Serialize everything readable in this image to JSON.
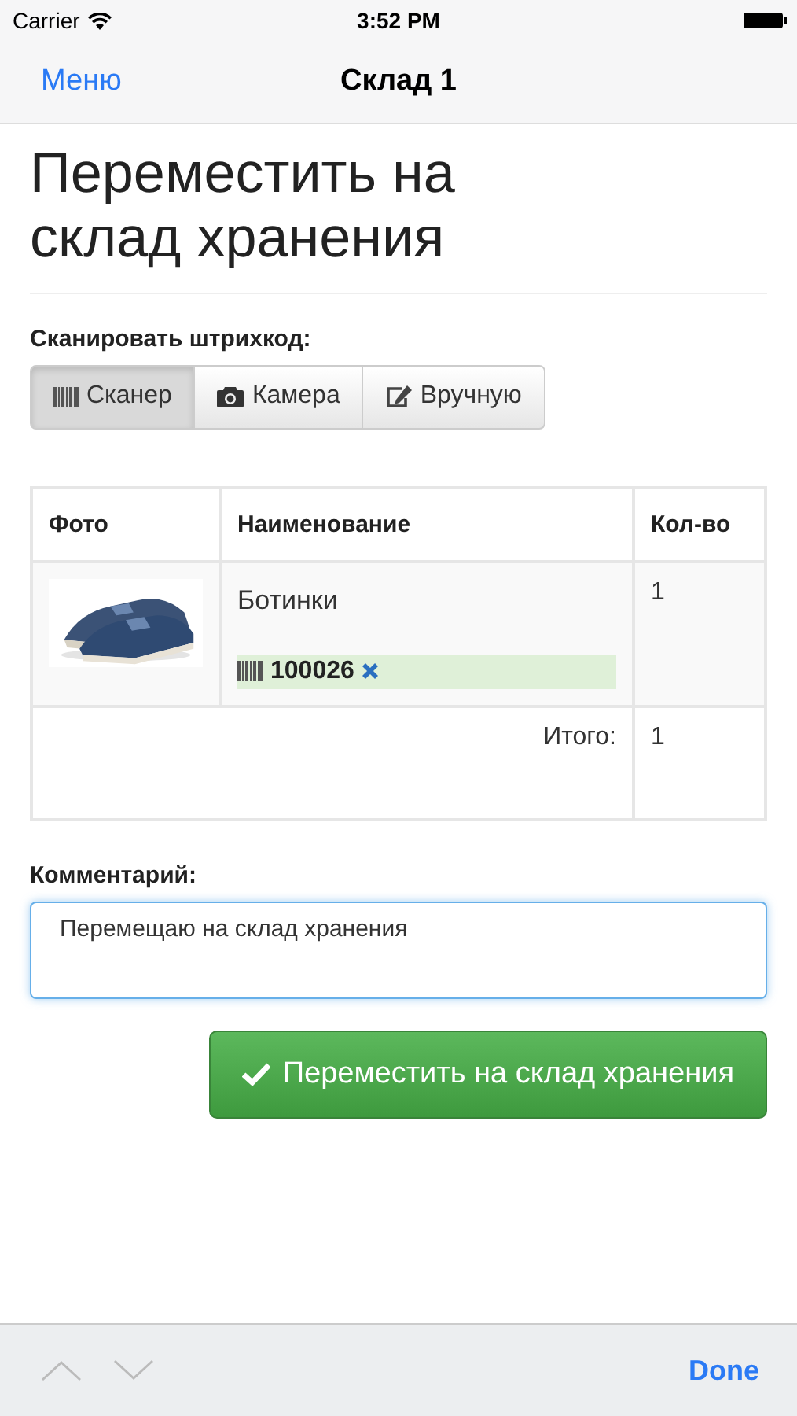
{
  "status_bar": {
    "carrier": "Carrier",
    "time": "3:52 PM"
  },
  "nav": {
    "back": "Меню",
    "title": "Склад 1"
  },
  "heading": "Переместить на склад хранения",
  "scan": {
    "label": "Сканировать штрихкод:",
    "options": [
      {
        "kind": "scanner",
        "label": "Сканер",
        "selected": true
      },
      {
        "kind": "camera",
        "label": "Камера",
        "selected": false
      },
      {
        "kind": "manual",
        "label": "Вручную",
        "selected": false
      }
    ]
  },
  "table": {
    "columns": [
      "Фото",
      "Наименование",
      "Кол-во"
    ],
    "rows": [
      {
        "name": "Ботинки",
        "barcode": "100026",
        "quantity": "1"
      }
    ],
    "total_label": "Итого:",
    "total": "1"
  },
  "comment": {
    "label": "Комментарий:",
    "value": "Перемещаю на склад хранения"
  },
  "submit": "Переместить на склад хранения",
  "keyboard_bar": {
    "done": "Done"
  }
}
